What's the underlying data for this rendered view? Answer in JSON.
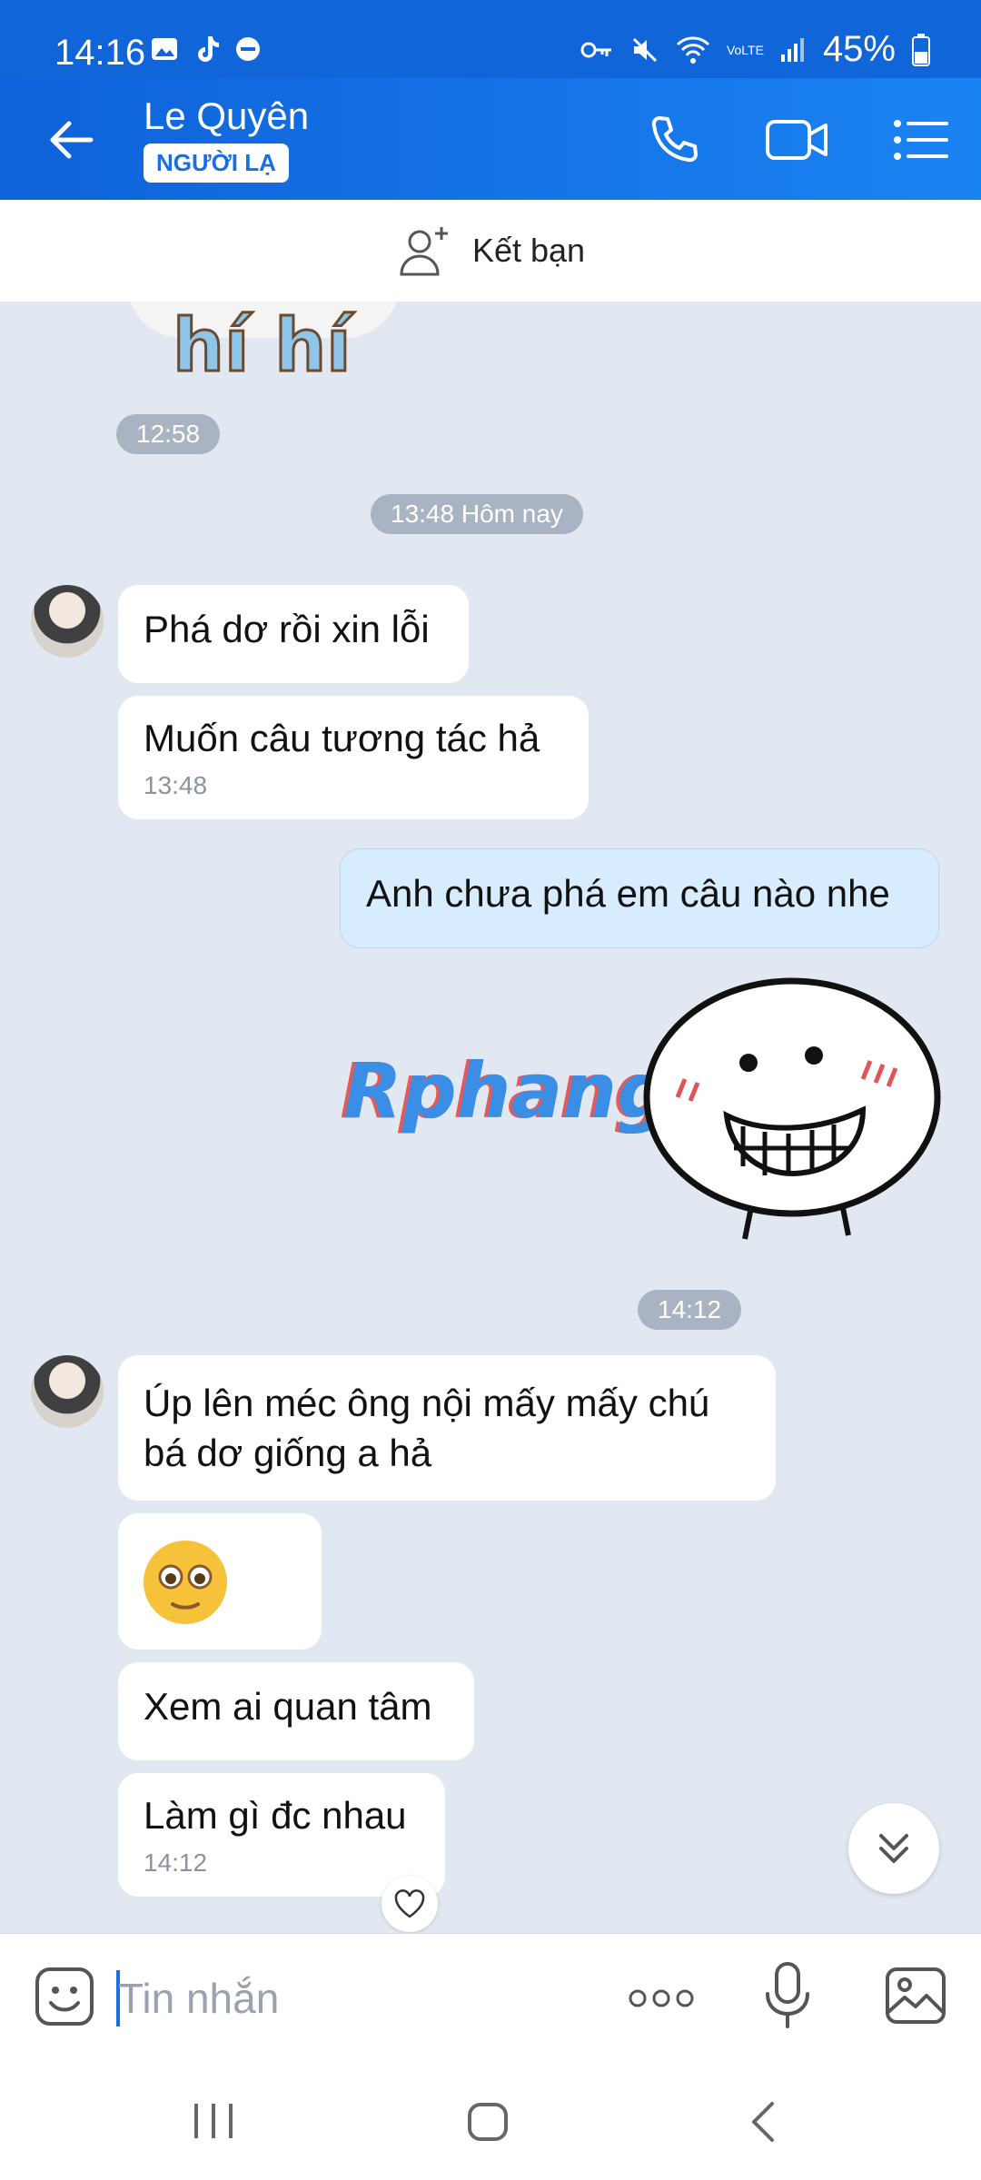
{
  "status_bar": {
    "time": "14:16",
    "battery": "45%",
    "network": "VoLTE"
  },
  "header": {
    "name": "Le Quyên",
    "badge": "NGƯỜI LẠ"
  },
  "add_friend": {
    "label": "Kết bạn"
  },
  "chat": {
    "sticker_text": "hí hí",
    "sticker_time": "12:58",
    "day_divider": "13:48 Hôm nay",
    "messages_1": [
      {
        "text": "Phá dơ rồi xin lỗi"
      },
      {
        "text": "Muốn câu tương tác hả",
        "time": "13:48"
      }
    ],
    "my_message": "Anh chưa phá em câu nào nhe",
    "watermark": "Rphang",
    "sticker2_time": "14:12",
    "messages_2": [
      {
        "text": "Úp lên méc ông nội mấy mấy chú bá dơ giống a hả"
      },
      {
        "text": "Xem ai quan tâm"
      },
      {
        "text": "Làm gì đc nhau",
        "time": "14:12"
      }
    ]
  },
  "input": {
    "placeholder": "Tin nhắn"
  },
  "colors": {
    "accent": "#1065d8",
    "chat_bg": "#e2e8f1",
    "my_bubble": "#d7ecfe"
  }
}
